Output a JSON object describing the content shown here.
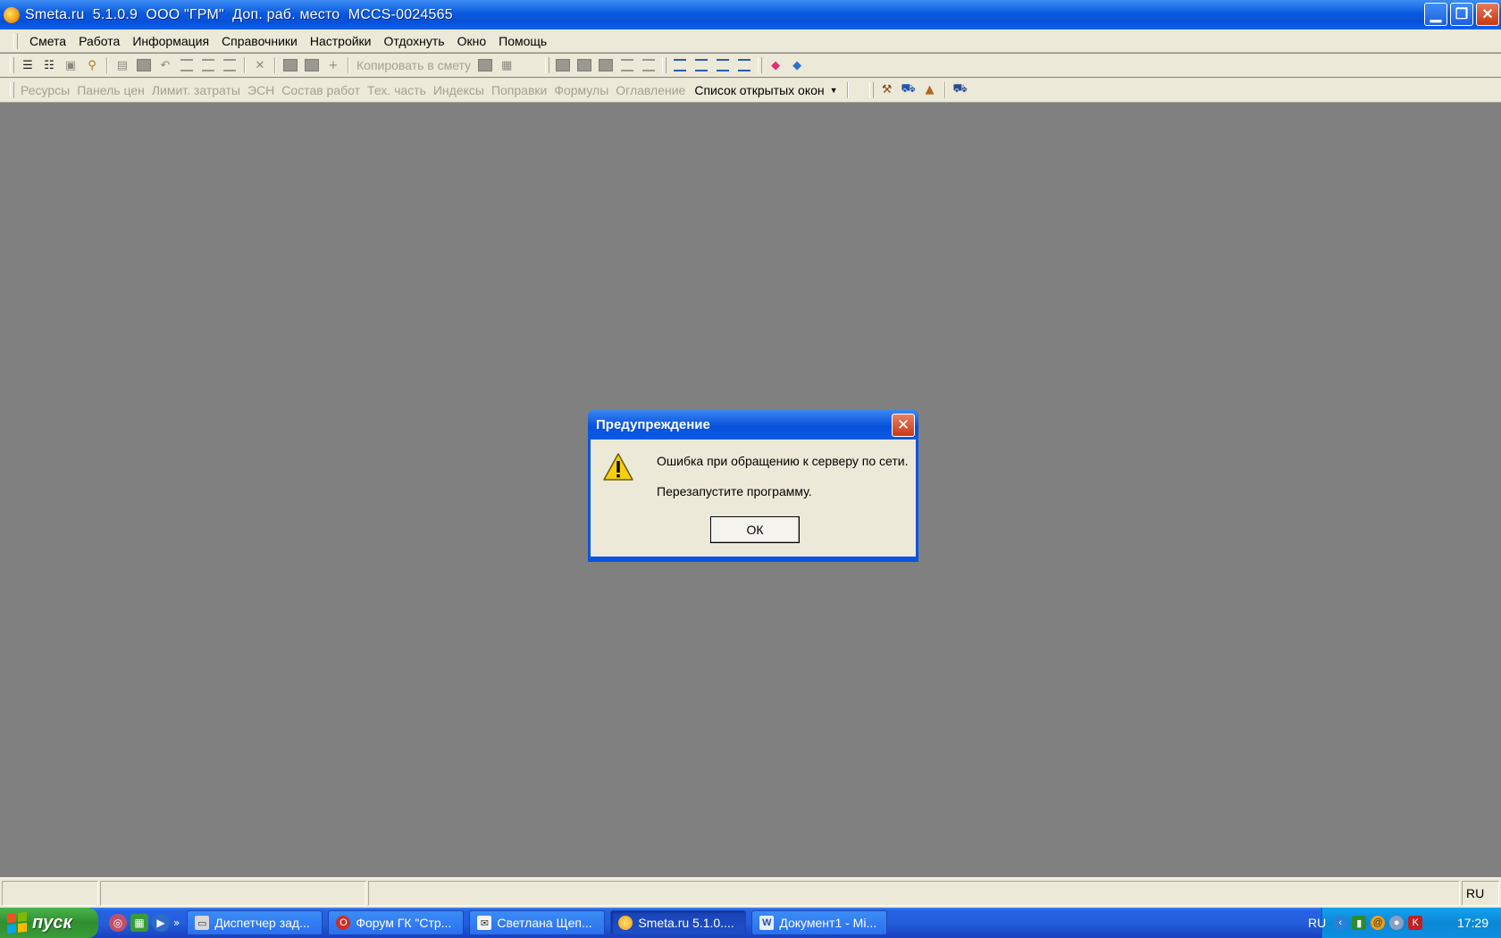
{
  "window": {
    "title": "Smeta.ru  5.1.0.9  ООО \"ГРМ\"  Доп. раб. место  MCCS-0024565"
  },
  "menu": [
    "Смета",
    "Работа",
    "Информация",
    "Справочники",
    "Настройки",
    "Отдохнуть",
    "Окно",
    "Помощь"
  ],
  "toolbar": {
    "copy_to_estimate": "Копировать в смету"
  },
  "toolbar2": {
    "items": [
      "Ресурсы",
      "Панель цен",
      "Лимит. затраты",
      "ЭСН",
      "Состав работ",
      "Тех. часть",
      "Индексы",
      "Поправки",
      "Формулы",
      "Оглавление"
    ],
    "open_windows": "Список открытых окон"
  },
  "dialog": {
    "title": "Предупреждение",
    "message_line1": "Ошибка при обращению к серверу по сети.",
    "message_line2": "Перезапустите программу.",
    "ok_label": "ОК"
  },
  "statusbar": {
    "lang_panel": "RU"
  },
  "taskbar": {
    "start_label": "пуск",
    "buttons": [
      "Диспетчер зад...",
      "Форум ГК \"Стр...",
      "Светлана Щеп...",
      "Smeta.ru  5.1.0....",
      "Документ1 - Mi..."
    ],
    "tray_lang": "RU",
    "clock": "17:29"
  },
  "colors": {
    "title_blue": "#0a54e3",
    "workspace": "#808080",
    "face": "#ece9d8",
    "start_green": "#3a9b3a"
  }
}
